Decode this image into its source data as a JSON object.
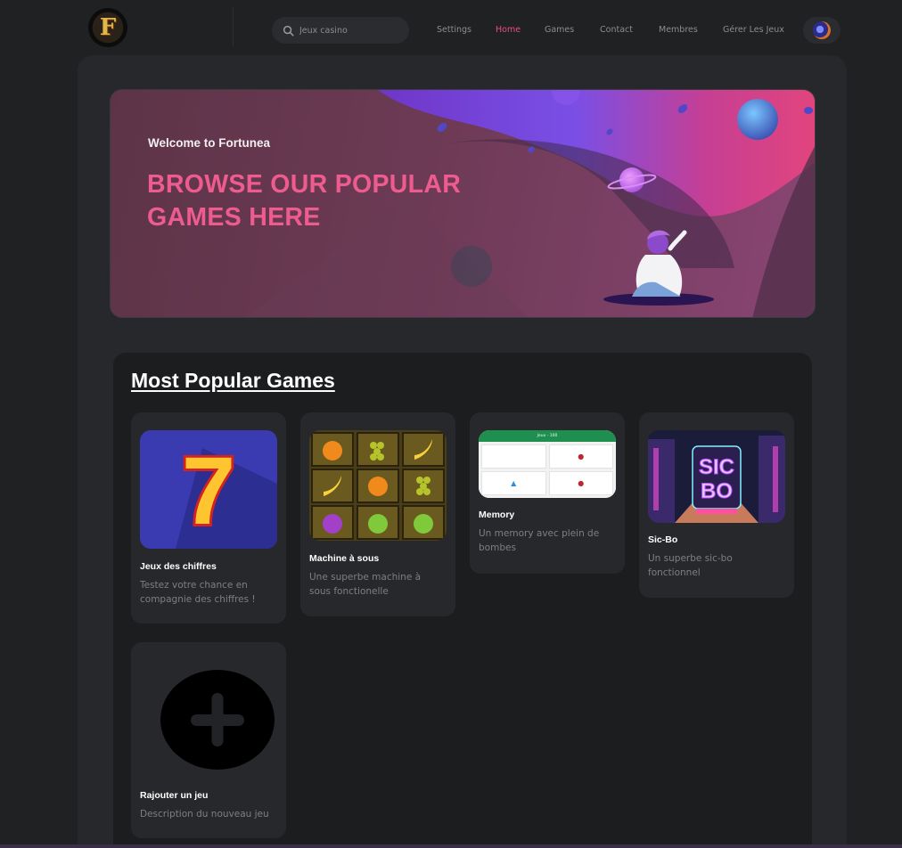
{
  "header": {
    "logo_letter": "F",
    "search": {
      "placeholder": "Jeux casino"
    },
    "nav": [
      {
        "label": "Settings",
        "active": false
      },
      {
        "label": "Home",
        "active": true
      },
      {
        "label": "Games",
        "active": false
      },
      {
        "label": "Contact",
        "active": false
      },
      {
        "label": "Membres",
        "active": false
      },
      {
        "label": "Gérer Les Jeux",
        "active": false
      }
    ]
  },
  "banner": {
    "kicker": "Welcome to Fortunea",
    "title": "BROWSE OUR POPULAR GAMES HERE"
  },
  "section": {
    "title": "Most Popular Games"
  },
  "games": [
    {
      "title": "Jeux des chiffres",
      "description": "Testez votre chance en compagnie des chiffres !",
      "thumb_icon": "lucky-seven-icon"
    },
    {
      "title": "Machine à sous",
      "description": "Une superbe machine à sous fonctionelle",
      "thumb_icon": "fruit-slots-icon"
    },
    {
      "title": "Memory",
      "description": "Un memory avec plein de bombes",
      "thumb_icon": "memory-board-icon",
      "thumb_header": "Jeux - 100"
    },
    {
      "title": "Sic-Bo",
      "description": "Un superbe sic-bo fonctionnel",
      "thumb_icon": "sic-bo-neon-icon",
      "thumb_text": "SIC BO"
    },
    {
      "title": "Rajouter un jeu",
      "description": "Description du nouveau jeu",
      "thumb_icon": "add-plus-icon"
    }
  ],
  "colors": {
    "background": "#202123",
    "panel": "#27282b",
    "accent": "#ea4c89",
    "banner_title": "#ee5b8e",
    "nav_inactive": "#8b8c90"
  }
}
